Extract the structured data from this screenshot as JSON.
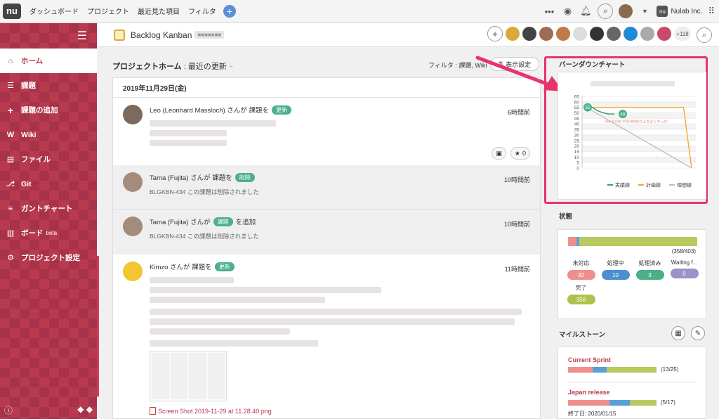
{
  "topbar": {
    "logo": "nu",
    "nav": [
      "ダッシュボード",
      "プロジェクト",
      "最近見た項目",
      "フィルタ"
    ],
    "org": "Nulab Inc."
  },
  "sidebar": {
    "items": [
      {
        "label": "ホーム",
        "icon": "home-icon"
      },
      {
        "label": "課題",
        "icon": "list-icon"
      },
      {
        "label": "課題の追加",
        "icon": "plus-icon"
      },
      {
        "label": "Wiki",
        "icon": "wiki-icon"
      },
      {
        "label": "ファイル",
        "icon": "folder-icon"
      },
      {
        "label": "Git",
        "icon": "git-icon"
      },
      {
        "label": "ガントチャート",
        "icon": "gantt-icon"
      },
      {
        "label": "ボード",
        "icon": "board-icon",
        "tag": "beta"
      },
      {
        "label": "プロジェクト設定",
        "icon": "gear-icon"
      }
    ]
  },
  "header": {
    "project_name": "Backlog Kanban",
    "more_members": "+118"
  },
  "main": {
    "title": "プロジェクトホーム",
    "subtitle": "最近の更新",
    "filter": "フィルタ : 課題, Wiki",
    "display_settings": "表示設定",
    "date": "2019年11月29日(金)",
    "entries": [
      {
        "user": "Leo (Leonhard Massloch) さんが 課題を",
        "badge": "更新",
        "time": "6時間前",
        "star_count": "0"
      },
      {
        "user": "Tama (Fujita) さんが 課題を",
        "badge": "削除",
        "time": "10時間前",
        "desc": "BLGKBN-434 この課題は削除されました"
      },
      {
        "user": "Tama (Fujita) さんが",
        "badge": "課題",
        "after": "を追加",
        "time": "10時間前",
        "desc": "BLGKBN-434 この課題は削除されました"
      },
      {
        "user": "Kimzo さんが 課題を",
        "badge": "更新",
        "time": "11時間前",
        "attachment": "Screen Shot 2019-11-29 at 11.28.40.png"
      }
    ]
  },
  "burndown": {
    "title": "バーンダウンチャート",
    "legend": [
      "実績線",
      "計画線",
      "理想線"
    ],
    "yticks": [
      "65",
      "60",
      "55",
      "50",
      "45",
      "40",
      "35",
      "30",
      "25",
      "20",
      "15",
      "10",
      "5",
      "0"
    ],
    "markers": [
      "55",
      "49"
    ],
    "note": "(lea 11/20) YOSHIWAIさんがよくやった!"
  },
  "chart_data": {
    "type": "line",
    "ylim": [
      0,
      65
    ],
    "series": [
      {
        "name": "実績線",
        "values": [
          55,
          55,
          52,
          50,
          49,
          49
        ]
      },
      {
        "name": "計画線",
        "values": [
          55,
          55,
          55,
          55,
          55,
          55,
          55,
          55,
          55,
          55,
          55,
          55,
          55,
          0
        ]
      },
      {
        "name": "理想線",
        "values": [
          55,
          0
        ]
      }
    ]
  },
  "status": {
    "title": "状態",
    "count": "(358/403)",
    "items": [
      {
        "label": "未対応",
        "value": "32",
        "color": "#ef8f8d"
      },
      {
        "label": "処理中",
        "value": "10",
        "color": "#4a8fd0"
      },
      {
        "label": "処理済み",
        "value": "3",
        "color": "#4caf8a"
      },
      {
        "label": "Waiting f...",
        "value": "0",
        "color": "#9c91c9"
      },
      {
        "label": "完了",
        "value": "358",
        "color": "#b0c24d"
      }
    ]
  },
  "milestones": {
    "title": "マイルストーン",
    "items": [
      {
        "name": "Current Sprint",
        "count": "(13/25)",
        "red": 0.28,
        "blue": 0.16
      },
      {
        "name": "Japan release",
        "count": "(5/17)",
        "end": "終了日: 2020/01/15",
        "red": 0.47,
        "blue": 0.23
      }
    ]
  },
  "colors": {
    "accent": "#b83a4e",
    "highlight": "#e8336d"
  }
}
